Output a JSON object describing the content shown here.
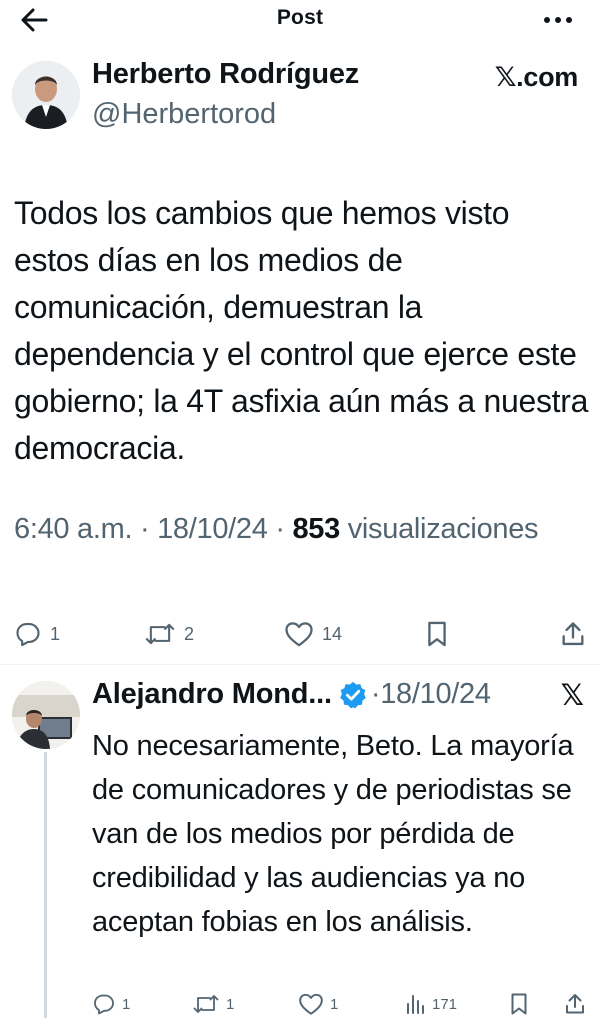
{
  "topbar": {
    "title": "Post"
  },
  "post": {
    "author_name": "Herberto Rodríguez",
    "author_handle": "@Herbertorod",
    "source_label": ".com",
    "text": "Todos los cambios que hemos visto estos días en los medios de comunicación, demuestran la dependencia y el control que ejerce este gobierno; la 4T asfixia aún más a nuestra democracia.",
    "time": "6:40 a.m.",
    "date": "18/10/24",
    "views_count": "853",
    "views_label": "visualizaciones",
    "separator": " · ",
    "replies": "1",
    "reposts": "2",
    "likes": "14"
  },
  "reply": {
    "author_name": "Alejandro Mond...",
    "date": "·18/10/24",
    "text": "No necesariamente, Beto. La mayoría de comunicadores y de periodistas se van de los medios por pérdida de credibilidad y las audiencias ya no aceptan fobias en los análisis.",
    "replies": "1",
    "reposts": "1",
    "likes": "1",
    "views": "171"
  },
  "colors": {
    "text": "#0f1419",
    "secondary": "#536471",
    "verified_blue": "#1d9bf0",
    "divider": "#eff3f4"
  },
  "icons": [
    "back-arrow-icon",
    "more-icon",
    "x-logo-icon",
    "reply-icon",
    "repost-icon",
    "like-icon",
    "bookmark-icon",
    "share-icon",
    "verified-icon",
    "views-icon"
  ]
}
